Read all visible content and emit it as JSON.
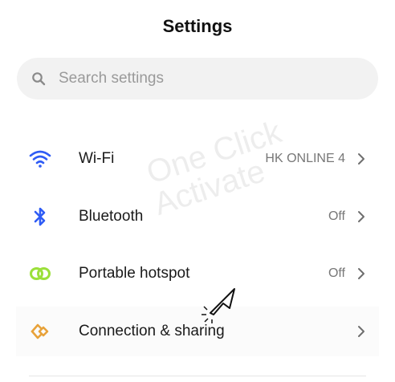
{
  "header": {
    "title": "Settings"
  },
  "search": {
    "placeholder": "Search settings"
  },
  "items": [
    {
      "label": "Wi-Fi",
      "value": "HK ONLINE 4",
      "icon": "wifi-icon",
      "icon_color": "#2f5cf5"
    },
    {
      "label": "Bluetooth",
      "value": "Off",
      "icon": "bluetooth-icon",
      "icon_color": "#2f5cf5"
    },
    {
      "label": "Portable hotspot",
      "value": "Off",
      "icon": "hotspot-icon",
      "icon_color": "#9be03a"
    },
    {
      "label": "Connection & sharing",
      "value": "",
      "icon": "connection-sharing-icon",
      "icon_color": "#e8a23a"
    }
  ],
  "watermark": {
    "line1": "One Click",
    "line2": "Activate"
  }
}
